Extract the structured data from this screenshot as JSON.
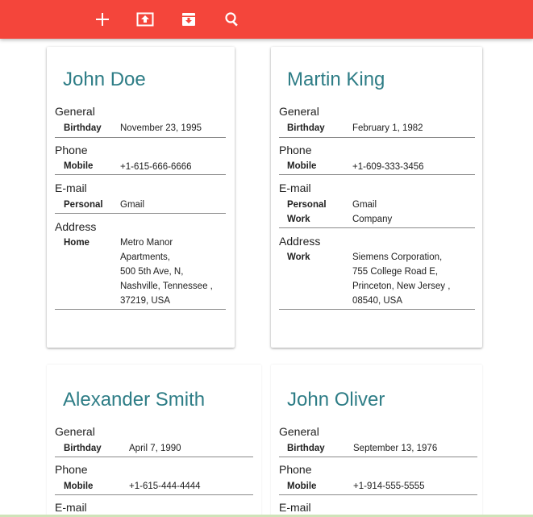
{
  "toolbar": {
    "color": "#f4453b",
    "icons": [
      "add-icon",
      "upload-icon",
      "download-icon",
      "search-icon"
    ]
  },
  "cards": [
    {
      "name": "John Doe",
      "general_label": "General",
      "birthday_label": "Birthday",
      "birthday": "November 23, 1995",
      "phone_label": "Phone",
      "mobile_label": "Mobile",
      "mobile": "+1-615-666-6666",
      "email_label": "E-mail",
      "personal_label": "Personal",
      "personal": "Gmail",
      "address_label": "Address",
      "home_label": "Home",
      "home_lines": [
        "Metro Manor",
        "Apartments,",
        "500 5th Ave, N,",
        "Nashville, Tennessee ,",
        "37219,  USA"
      ]
    },
    {
      "name": "Martin King",
      "general_label": "General",
      "birthday_label": "Birthday",
      "birthday": "February 1, 1982",
      "phone_label": "Phone",
      "mobile_label": "Mobile",
      "mobile": "+1-609-333-3456",
      "email_label": "E-mail",
      "personal_label": "Personal",
      "personal": "Gmail",
      "work_email_label": "Work",
      "work_email": "Company",
      "address_label": "Address",
      "work_label": "Work",
      "work_lines": [
        "Siemens Corporation,",
        "755 College Road E,",
        "Princeton, New Jersey ,",
        "08540,  USA"
      ]
    },
    {
      "name": "Alexander Smith",
      "general_label": "General",
      "birthday_label": "Birthday",
      "birthday": "April 7, 1990",
      "phone_label": "Phone",
      "mobile_label": "Mobile",
      "mobile": "+1-615-444-4444",
      "email_label": "E-mail"
    },
    {
      "name": "John Oliver",
      "general_label": "General",
      "birthday_label": "Birthday",
      "birthday": "September 13, 1976",
      "phone_label": "Phone",
      "mobile_label": "Mobile",
      "mobile": "+1-914-555-5555",
      "email_label": "E-mail"
    }
  ]
}
